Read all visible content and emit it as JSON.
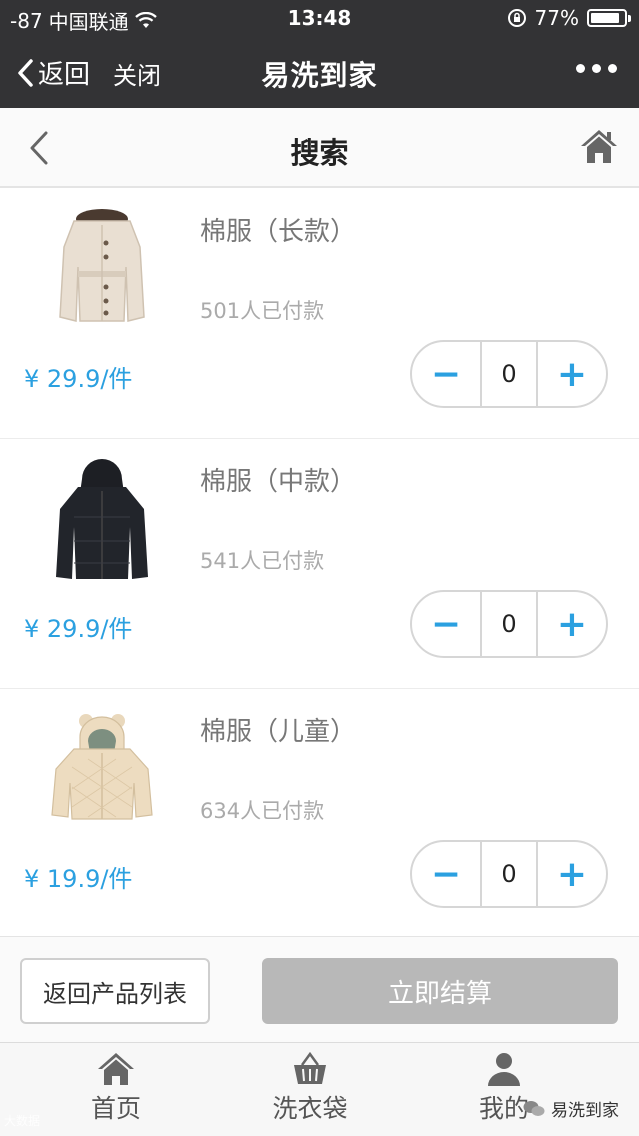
{
  "status_bar": {
    "signal": "-87",
    "carrier": "中国联通",
    "time": "13:48",
    "battery": "77%"
  },
  "wechat_header": {
    "back_label": "返回",
    "close_label": "关闭",
    "title": "易洗到家"
  },
  "page_header": {
    "title": "搜索"
  },
  "products": [
    {
      "name": "棉服（长款）",
      "sold": "501人已付款",
      "price": "¥ 29.9/件",
      "quantity": "0"
    },
    {
      "name": "棉服（中款）",
      "sold": "541人已付款",
      "price": "¥ 29.9/件",
      "quantity": "0"
    },
    {
      "name": "棉服（儿童）",
      "sold": "634人已付款",
      "price": "¥ 19.9/件",
      "quantity": "0"
    }
  ],
  "stepper": {
    "minus": "−",
    "plus": "+"
  },
  "action_bar": {
    "back_list_label": "返回产品列表",
    "checkout_label": "立即结算"
  },
  "tabs": [
    {
      "label": "首页",
      "icon": "home-icon"
    },
    {
      "label": "洗衣袋",
      "icon": "basket-icon"
    },
    {
      "label": "我的",
      "icon": "user-icon"
    }
  ],
  "watermark": {
    "left": "大数据",
    "right": "易洗到家"
  },
  "colors": {
    "accent": "#2ba0e0",
    "header_bg": "#333335",
    "checkout_disabled": "#b8b8b8"
  }
}
